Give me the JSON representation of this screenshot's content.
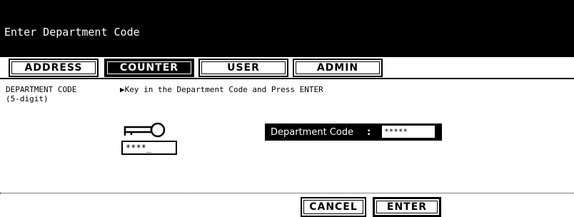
{
  "header": {
    "title": "Enter Department Code"
  },
  "tabs": [
    {
      "label": "ADDRESS",
      "active": false
    },
    {
      "label": "COUNTER",
      "active": true
    },
    {
      "label": "USER",
      "active": false
    },
    {
      "label": "ADMIN",
      "active": false
    }
  ],
  "prompt": {
    "left_line1": "DEPARTMENT CODE",
    "left_line2": "(5-digit)",
    "instruction": "▶Key in the Department Code and Press ENTER"
  },
  "code_display": "****_",
  "department_field": {
    "label": "Department Code",
    "separator": ":",
    "value": "*****"
  },
  "buttons": {
    "cancel": "CANCEL",
    "enter": "ENTER"
  },
  "icons": {
    "key": "key-icon"
  }
}
